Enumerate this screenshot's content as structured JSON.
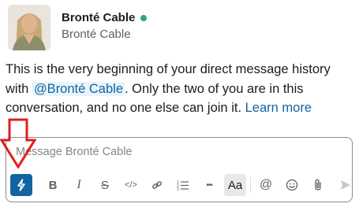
{
  "profile": {
    "name": "Bronté Cable",
    "subtitle": "Bronté Cable",
    "presence_color": "#2bac76"
  },
  "intro": {
    "before": "This is the very beginning of your direct message history with ",
    "mention": "@Bronté Cable",
    "after": ". Only the two of you are in this conversation, and no one else can join it. ",
    "link": "Learn more"
  },
  "composer": {
    "placeholder": "Message Bronté Cable",
    "value": ""
  },
  "toolbar": {
    "icons": [
      "lightning-icon",
      "bold-icon",
      "italic-icon",
      "strikethrough-icon",
      "code-icon",
      "link-icon",
      "numbered-list-icon",
      "more-icon",
      "formatting-toggle-icon",
      "at-icon",
      "emoji-icon",
      "attach-icon",
      "send-icon"
    ],
    "bold": "B",
    "italic": "I",
    "strike": "S",
    "code": "</>",
    "more": "•••",
    "aa": "Aa",
    "at": "@"
  },
  "colors": {
    "accent": "#1264a3",
    "annotation_arrow": "#e01e1e"
  }
}
